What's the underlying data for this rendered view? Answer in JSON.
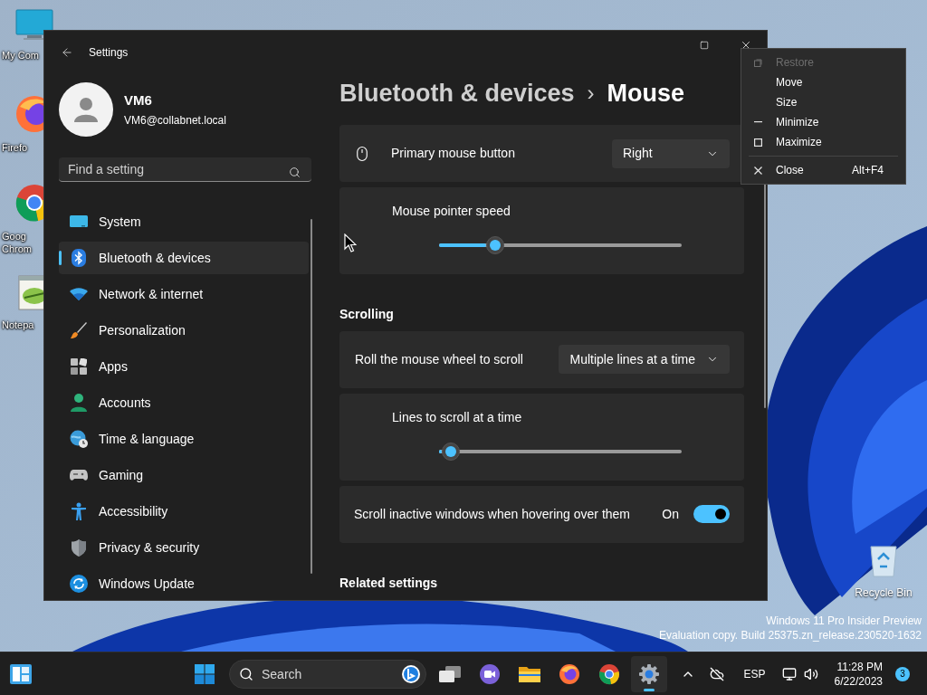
{
  "desktop": {
    "icons": [
      {
        "kind": "computer",
        "lines": [
          "My Com"
        ]
      },
      {
        "kind": "firefox",
        "lines": [
          "Firefo"
        ]
      },
      {
        "kind": "chrome",
        "lines": [
          "Goog",
          "Chrom"
        ]
      },
      {
        "kind": "notepad",
        "lines": [
          "Notepa"
        ]
      }
    ],
    "recycle_bin": {
      "label": "Recycle Bin"
    },
    "watermark": [
      "Windows 11 Pro Insider Preview",
      "Evaluation copy. Build 25375.zn_release.230520-1632"
    ]
  },
  "settings_window": {
    "title": "Settings",
    "user": {
      "name": "VM6",
      "email": "VM6@collabnet.local"
    },
    "search": {
      "placeholder": "Find a setting"
    },
    "nav": [
      {
        "kind": "system",
        "label": "System",
        "selected": false
      },
      {
        "kind": "bluetooth",
        "label": "Bluetooth & devices",
        "selected": true
      },
      {
        "kind": "network",
        "label": "Network & internet",
        "selected": false
      },
      {
        "kind": "personalization",
        "label": "Personalization",
        "selected": false
      },
      {
        "kind": "apps",
        "label": "Apps",
        "selected": false
      },
      {
        "kind": "accounts",
        "label": "Accounts",
        "selected": false
      },
      {
        "kind": "time",
        "label": "Time & language",
        "selected": false
      },
      {
        "kind": "gaming",
        "label": "Gaming",
        "selected": false
      },
      {
        "kind": "accessibility",
        "label": "Accessibility",
        "selected": false
      },
      {
        "kind": "privacy",
        "label": "Privacy & security",
        "selected": false
      },
      {
        "kind": "update",
        "label": "Windows Update",
        "selected": false
      }
    ],
    "breadcrumb": {
      "parent": "Bluetooth & devices",
      "separator": "›",
      "current": "Mouse"
    },
    "blocks": [
      {
        "kind": "dropdown",
        "icon": true,
        "label": "Primary mouse button",
        "value": "Right"
      },
      {
        "kind": "slider",
        "label": "Mouse pointer speed",
        "level": 0.23
      },
      {
        "kind": "heading",
        "label": "Scrolling"
      },
      {
        "kind": "dropdown",
        "icon": false,
        "label": "Roll the mouse wheel to scroll",
        "value": "Multiple lines at a time"
      },
      {
        "kind": "slider",
        "label": "Lines to scroll at a time",
        "level": 0.05
      },
      {
        "kind": "toggle",
        "label": "Scroll inactive windows when hovering over them",
        "state": "On",
        "on": true
      },
      {
        "kind": "heading",
        "label": "Related settings"
      }
    ]
  },
  "context_menu": {
    "items": [
      {
        "kind": "restore",
        "label": "Restore",
        "disabled": true
      },
      {
        "kind": "move",
        "label": "Move",
        "disabled": false
      },
      {
        "kind": "size",
        "label": "Size",
        "disabled": false
      },
      {
        "kind": "minimize",
        "label": "Minimize",
        "disabled": false
      },
      {
        "kind": "maximize",
        "label": "Maximize",
        "disabled": false
      },
      {
        "kind": "separator"
      },
      {
        "kind": "close",
        "label": "Close",
        "shortcut": "Alt+F4",
        "disabled": false
      }
    ]
  },
  "taskbar": {
    "search": {
      "placeholder": "Search"
    },
    "apps": [
      {
        "kind": "task-view",
        "active": false
      },
      {
        "kind": "chat",
        "active": false
      },
      {
        "kind": "explorer",
        "active": false
      },
      {
        "kind": "firefox",
        "active": false
      },
      {
        "kind": "chrome",
        "active": false
      },
      {
        "kind": "settings",
        "active": true
      }
    ],
    "tray": {
      "language": "ESP",
      "time": "11:28 PM",
      "date": "6/22/2023",
      "notifications": "3"
    }
  }
}
